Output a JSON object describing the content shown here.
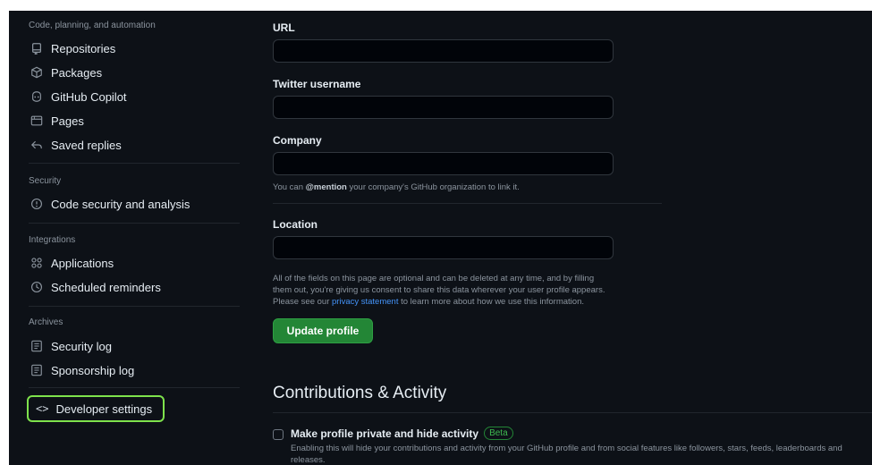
{
  "sidebar": {
    "groups": [
      {
        "title": "Code, planning, and automation",
        "items": [
          {
            "label": "Repositories",
            "icon": "repo-icon"
          },
          {
            "label": "Packages",
            "icon": "package-icon"
          },
          {
            "label": "GitHub Copilot",
            "icon": "copilot-icon"
          },
          {
            "label": "Pages",
            "icon": "browser-icon"
          },
          {
            "label": "Saved replies",
            "icon": "reply-icon"
          }
        ]
      },
      {
        "title": "Security",
        "items": [
          {
            "label": "Code security and analysis",
            "icon": "shield-icon"
          }
        ]
      },
      {
        "title": "Integrations",
        "items": [
          {
            "label": "Applications",
            "icon": "apps-icon"
          },
          {
            "label": "Scheduled reminders",
            "icon": "clock-icon"
          }
        ]
      },
      {
        "title": "Archives",
        "items": [
          {
            "label": "Security log",
            "icon": "log-icon"
          },
          {
            "label": "Sponsorship log",
            "icon": "log-icon"
          }
        ]
      }
    ],
    "developer_settings": {
      "label": "Developer settings",
      "icon": "code-icon",
      "glyph": "<>"
    }
  },
  "form": {
    "url": {
      "label": "URL",
      "value": ""
    },
    "twitter": {
      "label": "Twitter username",
      "value": ""
    },
    "company": {
      "label": "Company",
      "value": "",
      "note_prefix": "You can ",
      "note_mention": "@mention",
      "note_suffix": " your company's GitHub organization to link it."
    },
    "location": {
      "label": "Location",
      "value": ""
    },
    "disclaimer": {
      "line1": "All of the fields on this page are optional and can be deleted at any time, and by filling",
      "line2": "them out, you're giving us consent to share this data wherever your user profile appears.",
      "line3_prefix": "Please see our ",
      "line3_link": "privacy statement",
      "line3_suffix": " to learn more about how we use this information."
    },
    "update_button": "Update profile"
  },
  "contributions": {
    "heading": "Contributions & Activity",
    "private_label": "Make profile private and hide activity",
    "beta_badge": "Beta",
    "private_desc": "Enabling this will hide your contributions and activity from your GitHub profile and from social features like followers, stars, feeds, leaderboards and releases."
  },
  "colors": {
    "background": "#0d1117",
    "primary_button": "#238636",
    "link": "#4493f8",
    "highlight_outline": "#7ee24c"
  }
}
